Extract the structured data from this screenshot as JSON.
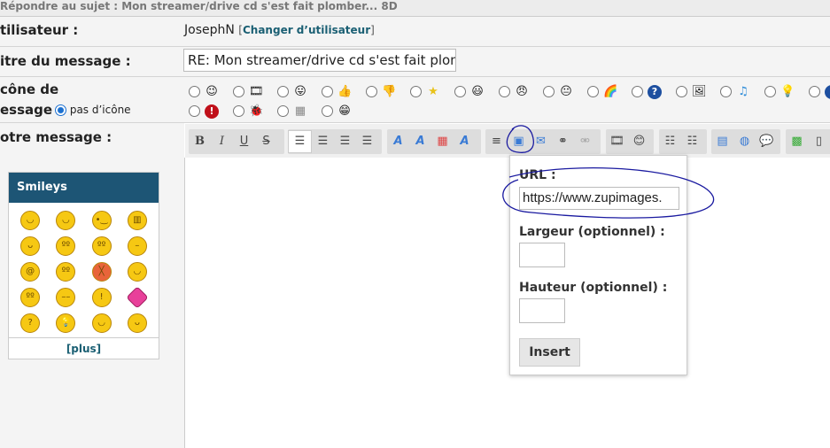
{
  "header": {
    "title": "Répondre au sujet : Mon streamer/drive cd s'est fait plomber... 8D"
  },
  "user": {
    "label": "tilisateur :",
    "name": "JosephN",
    "change_link": "Changer d’utilisateur",
    "bracket_open": "[",
    "bracket_close": "]"
  },
  "title": {
    "label": "itre du message :",
    "value": "RE: Mon streamer/drive cd s'est fait plombe"
  },
  "icon": {
    "label_line1": "cône de",
    "label_line2": "essage",
    "no_icon": "pas d’icône",
    "row1": [
      "wink",
      "film",
      "tongue",
      "thumbs-up",
      "thumbs-down",
      "star",
      "smile",
      "angry",
      "neutral",
      "rainbow",
      "question",
      "image",
      "music",
      "lightbulb",
      "info"
    ],
    "row2": [
      "exclamation",
      "bug",
      "wall",
      "grin"
    ]
  },
  "message": {
    "label": "otre message :"
  },
  "toolbar": {
    "bold": "B",
    "italic": "I",
    "underline": "U",
    "strike": "S"
  },
  "smileys": {
    "title": "Smileys",
    "more": "[plus]"
  },
  "popup": {
    "url_label": "URL :",
    "url_value": "https://www.zupimages.",
    "width_label": "Largeur (optionnel) :",
    "height_label": "Hauteur (optionnel) :",
    "insert": "Insert"
  },
  "colors": {
    "header_bg": "#1d5575",
    "link": "#1a5f73",
    "annotation": "#1a1aa0"
  }
}
